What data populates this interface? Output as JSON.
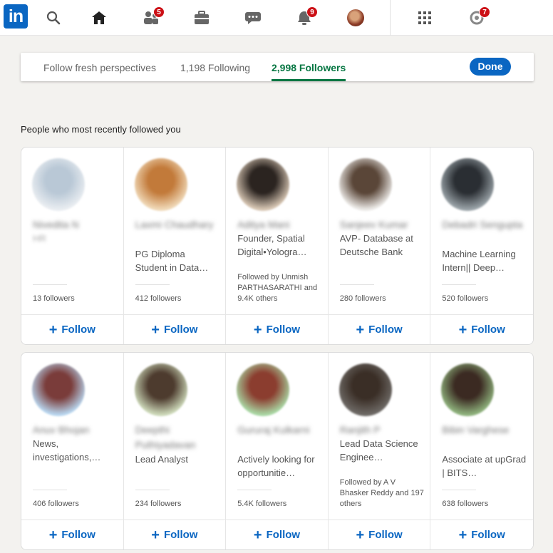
{
  "nav": {
    "logo": "in",
    "notifications_badge": "9",
    "network_badge": "5",
    "premium_badge": "7"
  },
  "tabs": {
    "perspectives": "Follow fresh perspectives",
    "following": "1,198 Following",
    "followers": "2,998 Followers",
    "done": "Done"
  },
  "section_title": "People who most recently followed you",
  "follow_label": "Follow",
  "row1": [
    {
      "name": "Nivedita N",
      "headline": "HR",
      "headline_blurred": true,
      "mutual": "",
      "followers": "13 followers",
      "avatar_colors": [
        "#b9c8d6",
        "#e9edf1"
      ]
    },
    {
      "name": "Laxmi Chaudhary",
      "headline": "PG Diploma Student in Data…",
      "headline_blurred": false,
      "mutual": "",
      "followers": "412 followers",
      "avatar_colors": [
        "#c27a3a",
        "#f0d9b8"
      ]
    },
    {
      "name": "Aditya Mani",
      "headline": "Founder, Spatial Digital•Yologra…",
      "headline_blurred": false,
      "mutual": "Followed by Unmish PARTHASARATHI and 9.4K others",
      "followers": "",
      "avatar_colors": [
        "#2b2420",
        "#d8c7b4"
      ]
    },
    {
      "name": "Sanjeev Kumar",
      "headline": "AVP- Database at Deutsche Bank",
      "headline_blurred": false,
      "mutual": "",
      "followers": "280 followers",
      "avatar_colors": [
        "#5a4638",
        "#eceae7"
      ]
    },
    {
      "name": "Debadri Sengupta",
      "headline": "Machine Learning Intern|| Deep…",
      "headline_blurred": false,
      "mutual": "",
      "followers": "520 followers",
      "avatar_colors": [
        "#2a2e33",
        "#9aa3a8"
      ]
    }
  ],
  "row2": [
    {
      "name": "Anuv Bhojan",
      "headline": "News, investigations,…",
      "headline_blurred": false,
      "mutual": "",
      "followers": "406 followers",
      "avatar_colors": [
        "#7a3c3a",
        "#b8d6ef"
      ]
    },
    {
      "name": "Deepthi Puthiyadavan",
      "headline": "Lead Analyst",
      "headline_blurred": false,
      "mutual": "",
      "followers": "234 followers",
      "avatar_colors": [
        "#4d3b2e",
        "#cdd9b9"
      ]
    },
    {
      "name": "Gururaj Kulkarni",
      "headline": "Actively looking for opportunitie…",
      "headline_blurred": false,
      "mutual": "",
      "followers": "5.4K followers",
      "avatar_colors": [
        "#8b3d2f",
        "#a9d8a4"
      ]
    },
    {
      "name": "Ranjith P",
      "headline": "Lead Data Science Enginee…",
      "headline_blurred": false,
      "mutual": "Followed by A V Bhasker Reddy and 197 others",
      "followers": "",
      "avatar_colors": [
        "#3a2e26",
        "#6e6a66"
      ]
    },
    {
      "name": "Bibin Varghese",
      "headline": "Associate at upGrad | BITS…",
      "headline_blurred": false,
      "mutual": "",
      "followers": "638 followers",
      "avatar_colors": [
        "#3b2a22",
        "#8fb37d"
      ]
    }
  ]
}
